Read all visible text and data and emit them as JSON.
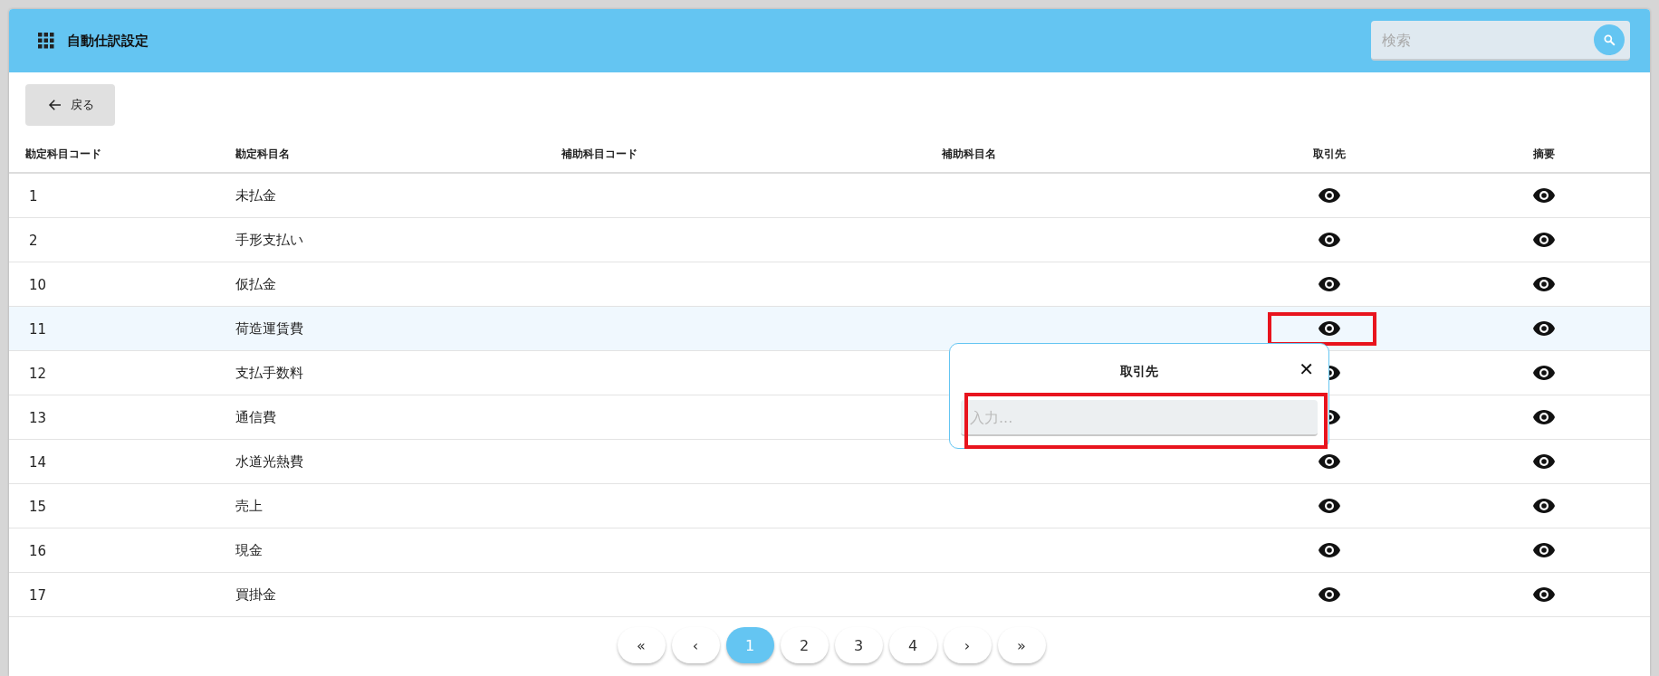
{
  "header": {
    "title": "自動仕訳設定",
    "search": {
      "placeholder": "検索"
    }
  },
  "back_button": {
    "label": "戻る"
  },
  "table": {
    "columns": [
      "勘定科目コード",
      "勘定科目名",
      "補助科目コード",
      "補助科目名",
      "取引先",
      "摘要"
    ],
    "rows": [
      {
        "code": "1",
        "name": "未払金",
        "selected": false
      },
      {
        "code": "2",
        "name": "手形支払い",
        "selected": false
      },
      {
        "code": "10",
        "name": "仮払金",
        "selected": false
      },
      {
        "code": "11",
        "name": "荷造運賃費",
        "selected": true
      },
      {
        "code": "12",
        "name": "支払手数料",
        "selected": false
      },
      {
        "code": "13",
        "name": "通信費",
        "selected": false
      },
      {
        "code": "14",
        "name": "水道光熱費",
        "selected": false
      },
      {
        "code": "15",
        "name": "売上",
        "selected": false
      },
      {
        "code": "16",
        "name": "現金",
        "selected": false
      },
      {
        "code": "17",
        "name": "買掛金",
        "selected": false
      }
    ]
  },
  "popover": {
    "title": "取引先",
    "close": "✕",
    "input": {
      "placeholder": "入力..."
    }
  },
  "pagination": [
    {
      "label": "«",
      "selected": false
    },
    {
      "label": "‹",
      "selected": false
    },
    {
      "label": "1",
      "selected": true
    },
    {
      "label": "2",
      "selected": false
    },
    {
      "label": "3",
      "selected": false
    },
    {
      "label": "4",
      "selected": false
    },
    {
      "label": "›",
      "selected": false
    },
    {
      "label": "»",
      "selected": false
    }
  ]
}
